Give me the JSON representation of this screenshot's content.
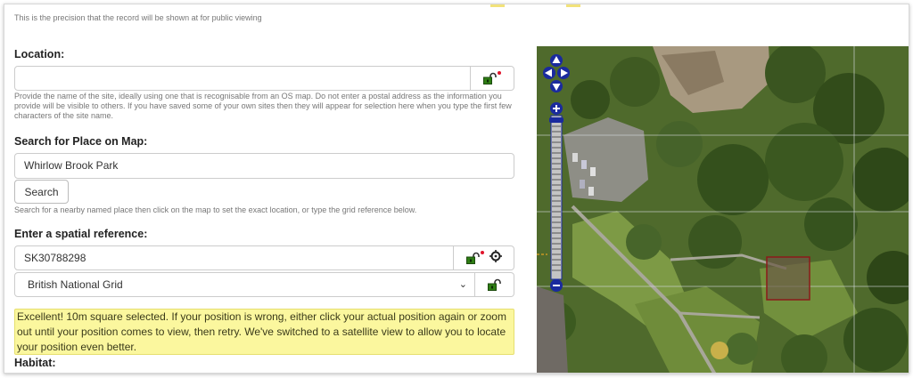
{
  "precision_help": "This is the precision that the record will be shown at for public viewing",
  "location": {
    "label": "Location:",
    "value": "",
    "help": "Provide the name of the site, ideally using one that is recognisable from an OS map. Do not enter a postal address as the information you provide will be visible to others. If you have saved some of your own sites then they will appear for selection here when you type the first few characters of the site name."
  },
  "search": {
    "label": "Search for Place on Map:",
    "value": "Whirlow Brook Park",
    "button_label": "Search",
    "help": "Search for a nearby named place then click on the map to set the exact location, or type the grid reference below."
  },
  "spatial_ref": {
    "label": "Enter a spatial reference:",
    "value": "SK30788298",
    "system_selected": "British National Grid"
  },
  "alert_text": "Excellent! 10m square selected. If your position is wrong, either click your actual position again or zoom out until your position comes to view, then retry. We've switched to a satellite view to allow you to locate your position even better.",
  "habitat_label": "Habitat:",
  "colors": {
    "accent_nav": "#1a2a9e",
    "lock_green": "#2e7d14",
    "required_red": "#e0142b",
    "alert_bg": "#fbf79e",
    "selection_square": "#8b1a1a"
  },
  "icons": [
    "lock-open-icon",
    "crosshair-icon",
    "chevron-down-icon",
    "pan-up-icon",
    "pan-down-icon",
    "pan-left-icon",
    "pan-right-icon",
    "zoom-in-icon",
    "zoom-out-icon"
  ]
}
